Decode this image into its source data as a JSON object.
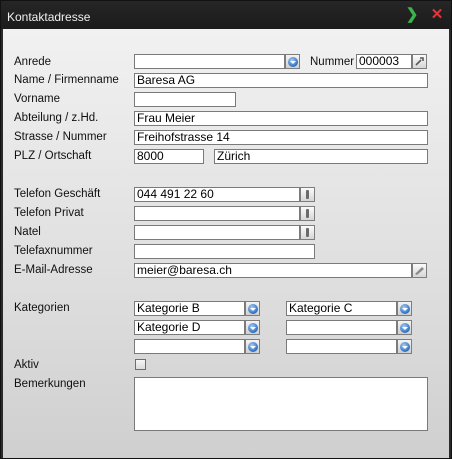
{
  "window": {
    "title": "Kontaktadresse",
    "ok_icon": "chevron-right-icon",
    "close_icon": "close-x-icon"
  },
  "labels": {
    "anrede": "Anrede",
    "nummer": "Nummer",
    "name": "Name / Firmenname",
    "vorname": "Vorname",
    "abteilung": "Abteilung / z.Hd.",
    "strasse": "Strasse / Nummer",
    "plz": "PLZ / Ortschaft",
    "tel_geschaeft": "Telefon Geschäft",
    "tel_privat": "Telefon Privat",
    "natel": "Natel",
    "fax": "Telefaxnummer",
    "email": "E-Mail-Adresse",
    "kategorien": "Kategorien",
    "aktiv": "Aktiv",
    "bemerkungen": "Bemerkungen"
  },
  "values": {
    "anrede": "",
    "nummer": "000003",
    "name": "Baresa  AG",
    "vorname": "",
    "abteilung": "Frau Meier",
    "strasse": "Freihofstrasse 14",
    "plz": "8000",
    "ort": "Zürich",
    "tel_geschaeft": "044 491 22 60",
    "tel_privat": "",
    "natel": "",
    "fax": "",
    "email": "meier@baresa.ch",
    "kategorie1": "Kategorie B",
    "kategorie2": "Kategorie C",
    "kategorie3": "Kategorie D",
    "kategorie4": "",
    "kategorie5": "",
    "kategorie6": "",
    "aktiv": false,
    "bemerkungen": ""
  },
  "colors": {
    "title_bg": "#1e1e1e",
    "ok_green": "#39b54a",
    "close_red": "#e8323a",
    "combo_blue": "#2b6fc0"
  }
}
